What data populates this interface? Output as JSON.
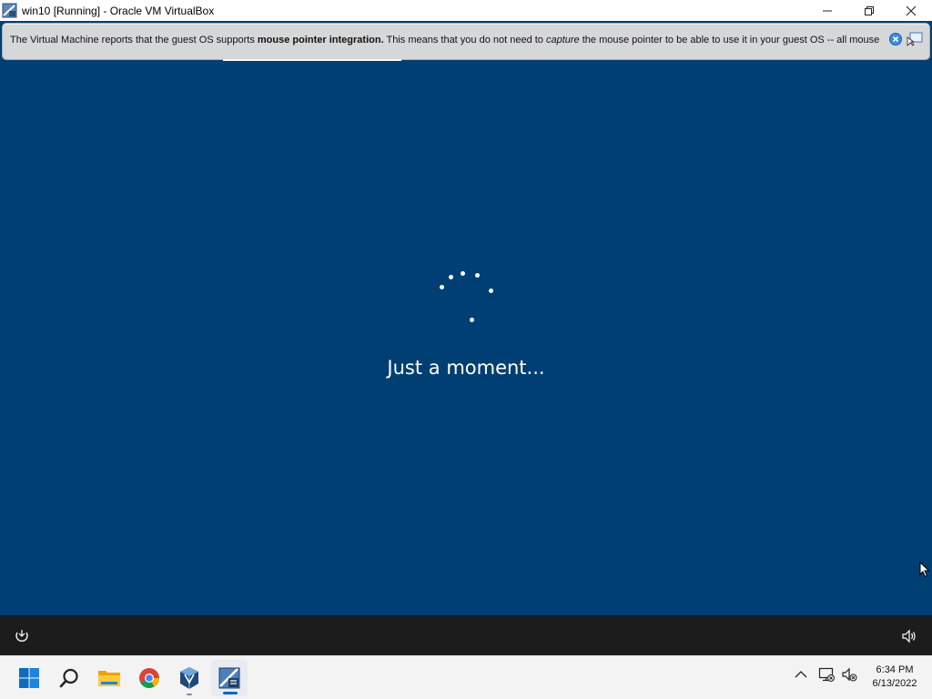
{
  "window": {
    "title": "win10 [Running] - Oracle VM VirtualBox",
    "controls": [
      "minimize",
      "restore",
      "close"
    ]
  },
  "notification": {
    "text_before": "The Virtual Machine reports that the guest OS supports ",
    "bold": "mouse pointer integration.",
    "text_middle": " This means that you do not need to ",
    "italic": "capture",
    "text_after": " the mouse pointer to be able to use it in your guest OS -- all mouse"
  },
  "guest": {
    "message": "Just a moment...",
    "background": "#003f73"
  },
  "taskbar": {
    "apps": [
      "start",
      "search",
      "file-explorer",
      "chrome",
      "virtualbox",
      "win10-vm"
    ],
    "time": "6:34 PM",
    "date": "6/13/2022"
  }
}
